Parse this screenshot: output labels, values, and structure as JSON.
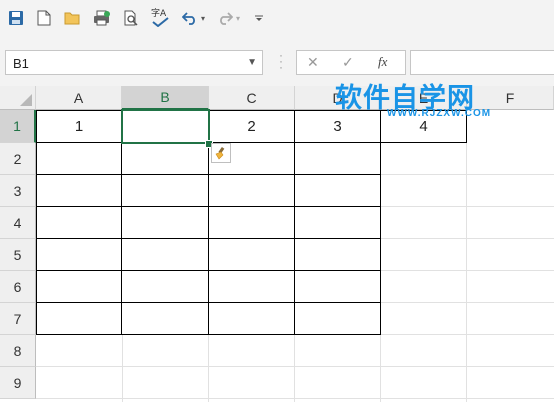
{
  "toolbar": {
    "icons": [
      "save-icon",
      "new-file-icon",
      "open-folder-icon",
      "print-icon",
      "print-preview-icon",
      "spell-check-icon",
      "undo-icon",
      "redo-icon",
      "customize-icon"
    ],
    "spell_glyph": "字A"
  },
  "formula_bar": {
    "name_box": "B1",
    "cancel_glyph": "✕",
    "enter_glyph": "✓",
    "fx_label": "fx",
    "formula": ""
  },
  "grid": {
    "columns": [
      "A",
      "B",
      "C",
      "D",
      "E",
      "F"
    ],
    "rows": [
      "1",
      "2",
      "3",
      "4",
      "5",
      "6",
      "7",
      "8",
      "9"
    ],
    "selected_cell": "B1",
    "row1": {
      "A": "1",
      "B": "",
      "C": "2",
      "D": "3",
      "E": "4"
    }
  },
  "watermark": {
    "cn": "软件自学网",
    "url": "WWW.RJZXW.COM"
  },
  "colors": {
    "accent": "#217346",
    "watermark": "#1a94e6",
    "save_icon": "#2c6aa6"
  }
}
